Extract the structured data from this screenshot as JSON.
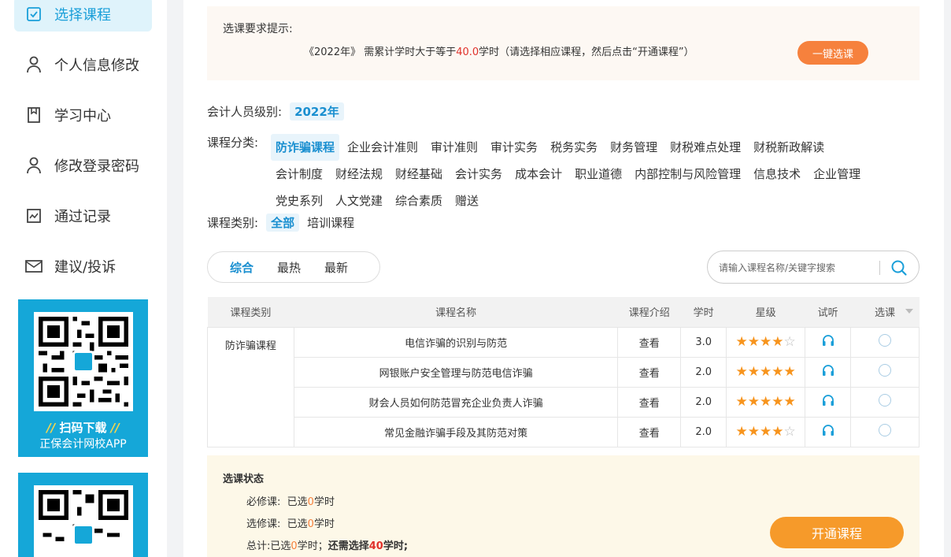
{
  "sidebar": {
    "items": [
      {
        "label": "选择课程",
        "icon": "checkbox-icon",
        "active": true
      },
      {
        "label": "个人信息修改",
        "icon": "user-icon"
      },
      {
        "label": "学习中心",
        "icon": "book-icon"
      },
      {
        "label": "修改登录密码",
        "icon": "user-icon"
      },
      {
        "label": "通过记录",
        "icon": "chart-icon"
      },
      {
        "label": "建议/投诉",
        "icon": "mail-icon"
      }
    ],
    "app_card": {
      "title": "扫码下载",
      "subtitle": "正保会计网校APP"
    }
  },
  "tip": {
    "title": "选课要求提示:",
    "text_prefix": "《2022年》 需累计学时大于等于",
    "hours": "40.0",
    "text_suffix": "学时（请选择相应课程，然后点击“开通课程”）",
    "quick_button": "一键选课"
  },
  "filters": {
    "level_label": "会计人员级别:",
    "level_value": "2022年",
    "category_label": "课程分类:",
    "categories": [
      "防诈骗课程",
      "企业会计准则",
      "审计准则",
      "审计实务",
      "税务实务",
      "财务管理",
      "财税难点处理",
      "财税新政解读",
      "会计制度",
      "财经法规",
      "财经基础",
      "会计实务",
      "成本会计",
      "职业道德",
      "内部控制与风险管理",
      "信息技术",
      "企业管理",
      "党史系列",
      "人文党建",
      "综合素质",
      "赠送"
    ],
    "type_label": "课程类别:",
    "types": [
      "全部",
      "培训课程"
    ]
  },
  "sort_tabs": [
    "综合",
    "最热",
    "最新"
  ],
  "search": {
    "placeholder": "请输入课程名称/关键字搜索"
  },
  "table": {
    "headers": [
      "课程类别",
      "课程名称",
      "课程介绍",
      "学时",
      "星级",
      "试听",
      "选课"
    ],
    "category": "防诈骗课程",
    "view_label": "查看",
    "rows": [
      {
        "name": "电信诈骗的识别与防范",
        "hours": "3.0",
        "rating": 4
      },
      {
        "name": "网银账户安全管理与防范电信诈骗",
        "hours": "2.0",
        "rating": 5
      },
      {
        "name": "财会人员如何防范冒充企业负责人诈骗",
        "hours": "2.0",
        "rating": 5
      },
      {
        "name": "常见金融诈骗手段及其防范对策",
        "hours": "2.0",
        "rating": 4
      }
    ]
  },
  "status": {
    "title": "选课状态",
    "required_label": "必修课:",
    "elective_label": "选修课:",
    "total_label": "总计:",
    "selected_prefix": "已选",
    "selected_value": "0",
    "unit": "学时",
    "total_sep": "；",
    "remaining_prefix": "还需选择",
    "remaining_value": "40",
    "remaining_suffix": "学时;",
    "open_button": "开通课程"
  },
  "colors": {
    "accent": "#1a9fd9",
    "orange": "#f6813d",
    "red": "#e0322b",
    "star": "#f7941d"
  }
}
